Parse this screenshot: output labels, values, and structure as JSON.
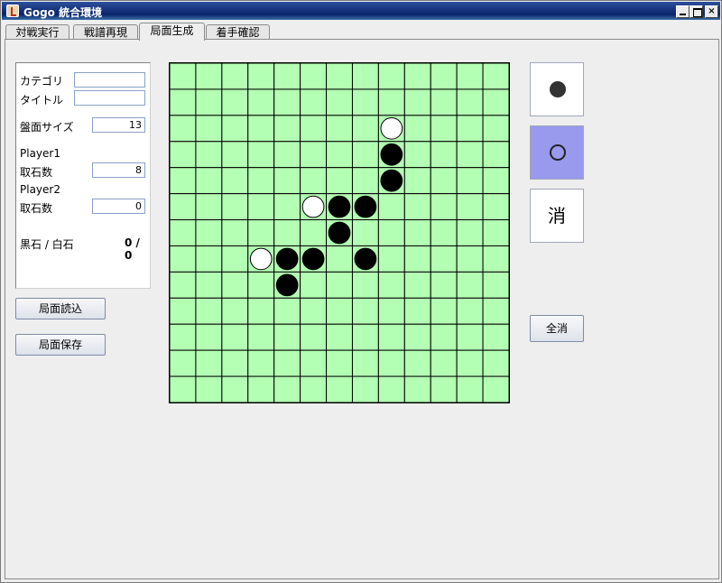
{
  "window": {
    "title": "Gogo 統合環境"
  },
  "tabs": [
    "対戦実行",
    "戦譜再現",
    "局面生成",
    "着手確認"
  ],
  "form": {
    "category_label": "カテゴリ",
    "category_value": "",
    "title_label": "タイトル",
    "title_value": "",
    "board_size_label": "盤面サイズ",
    "board_size_value": "13",
    "player1_label": "Player1",
    "player1_captured_label": "取石数",
    "player1_captured_value": "8",
    "player2_label": "Player2",
    "player2_captured_label": "取石数",
    "player2_captured_value": "0",
    "ratio_label": "黒石 / 白石",
    "ratio_value": "0 / 0"
  },
  "buttons": {
    "load": "局面読込",
    "save": "局面保存",
    "clear_all": "全消"
  },
  "tools": {
    "black": "●",
    "white": "○",
    "erase": "消",
    "selected": "white"
  },
  "board": {
    "size": 13,
    "stones": [
      {
        "row": 2,
        "col": 8,
        "color": "white"
      },
      {
        "row": 3,
        "col": 8,
        "color": "black"
      },
      {
        "row": 4,
        "col": 8,
        "color": "black"
      },
      {
        "row": 5,
        "col": 5,
        "color": "white"
      },
      {
        "row": 5,
        "col": 6,
        "color": "black"
      },
      {
        "row": 5,
        "col": 7,
        "color": "black"
      },
      {
        "row": 6,
        "col": 6,
        "color": "black"
      },
      {
        "row": 7,
        "col": 3,
        "color": "white"
      },
      {
        "row": 7,
        "col": 4,
        "color": "black"
      },
      {
        "row": 7,
        "col": 5,
        "color": "black"
      },
      {
        "row": 7,
        "col": 7,
        "color": "black"
      },
      {
        "row": 8,
        "col": 4,
        "color": "black"
      }
    ]
  },
  "colors": {
    "board_bg": "#b3ffb3",
    "selected_tool": "#9999ee",
    "titlebar": "#0a246a"
  }
}
